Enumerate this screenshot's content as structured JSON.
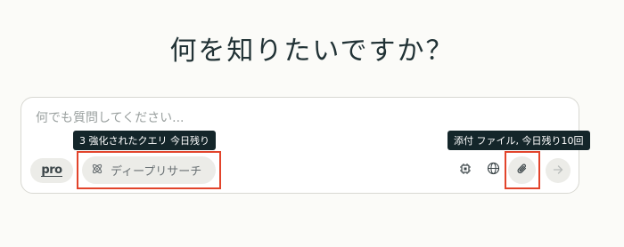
{
  "heading": "何を知りたいですか？",
  "search": {
    "placeholder": "何でも質問してください..."
  },
  "tooltips": {
    "deep_research": "3 強化されたクエリ 今日残り",
    "attach": "添付 ファイル, 今日残り10回"
  },
  "toolbar": {
    "pro_label": "pro",
    "deep_research_label": "ディープリサーチ"
  },
  "icons": {
    "deep_research": "atom-icon",
    "model": "chip-icon",
    "sources": "globe-icon",
    "attach": "paperclip-icon",
    "submit": "arrow-right-icon"
  },
  "colors": {
    "highlight": "#e2442b",
    "tooltip_bg": "#14262a"
  }
}
